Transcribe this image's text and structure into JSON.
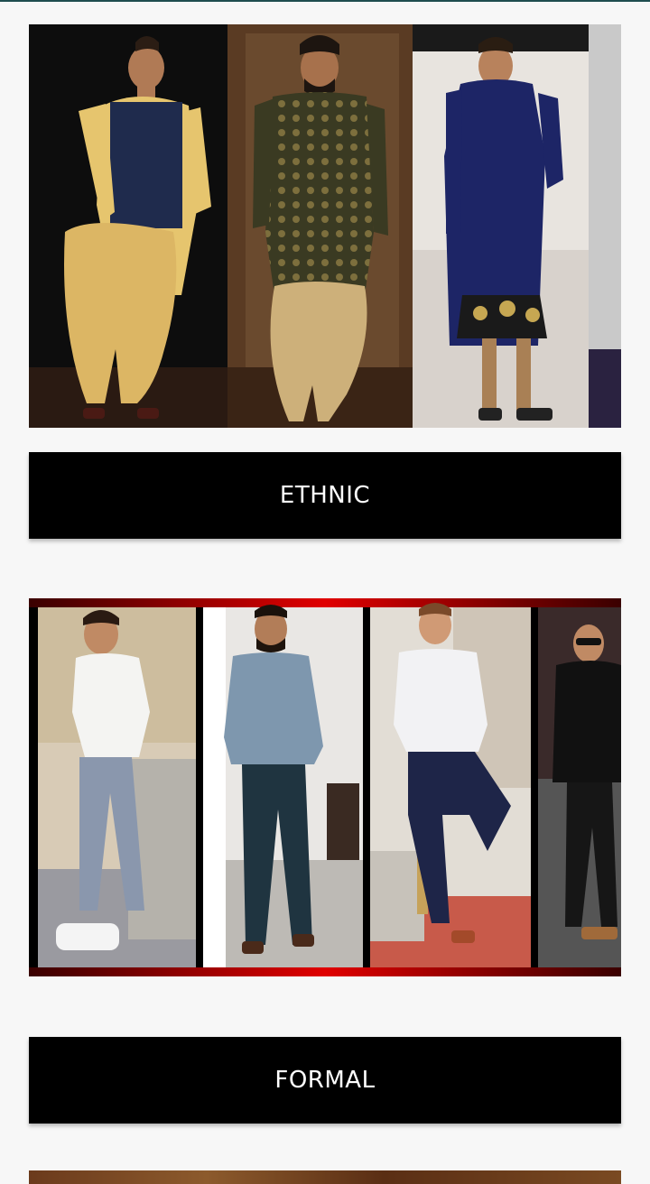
{
  "categories": [
    {
      "label": "ETHNIC",
      "image": "ethnic-wear-collage"
    },
    {
      "label": "FORMAL",
      "image": "formal-wear-collage"
    }
  ],
  "colors": {
    "background": "#f7f7f7",
    "bar": "#000000",
    "bar_text": "#ffffff",
    "frame_red": "#d40000"
  }
}
